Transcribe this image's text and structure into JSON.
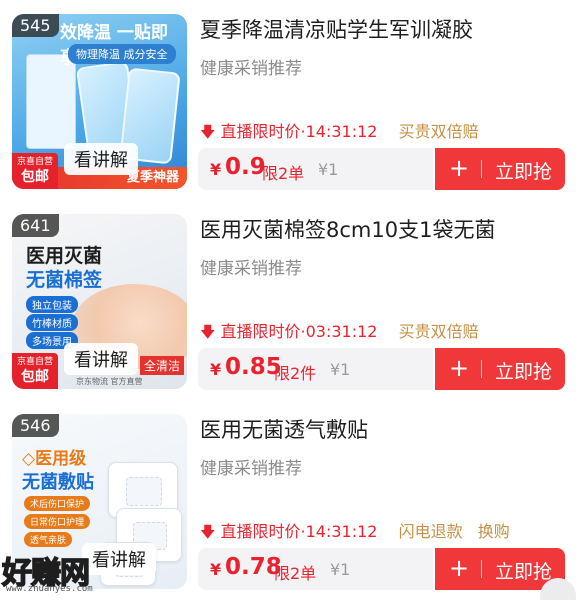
{
  "common": {
    "subtitle": "健康采销推荐",
    "live_label": "直播限时价",
    "buy_plus": "+",
    "buy_label": "立即抢",
    "currency": "¥",
    "explain_label": "看讲解",
    "self_tag_top": "京喜自营",
    "self_tag_bottom": "包邮"
  },
  "items": [
    {
      "id": "545",
      "title": "夏季降温清凉贴学生军训凝胶",
      "countdown": "14:31:12",
      "extra": "买贵双倍赔",
      "extra2": "",
      "price": "0.9",
      "limit": "限2单",
      "orig": "¥1",
      "thumb": {
        "banner": "效降温 一贴即享",
        "sub": "物理降温 成分安全",
        "bottom_strip": "夏季神器"
      }
    },
    {
      "id": "641",
      "title": "医用灭菌棉签8cm10支1袋无菌",
      "countdown": "03:31:12",
      "extra": "买贵双倍赔",
      "extra2": "",
      "price": "0.85",
      "limit": "限2件",
      "orig": "¥1",
      "thumb": {
        "title_line1": "医用灭菌",
        "title_line2": "无菌棉签",
        "bullets": [
          "独立包装",
          "竹棒材质",
          "多场景用"
        ],
        "band": "全清洁",
        "foot": "京东物流   官方直营"
      }
    },
    {
      "id": "546",
      "title": "医用无菌透气敷贴",
      "countdown": "14:31:12",
      "extra": "闪电退款",
      "extra2": "换购",
      "price": "0.78",
      "limit": "限2单",
      "orig": "¥1",
      "thumb": {
        "badge": "◇医用级",
        "title": "无菌敷贴",
        "tags": [
          "术后伤口保护",
          "日常伤口护理",
          "透气亲肤"
        ]
      }
    }
  ],
  "watermark": {
    "text": "好赚网",
    "url": "www.zhuanyes.com"
  },
  "colors": {
    "price_red": "#e8232f",
    "buy_button": "#f0383a",
    "guarantee_gold": "#c79045",
    "subtitle_gray": "#8b8b8b"
  }
}
